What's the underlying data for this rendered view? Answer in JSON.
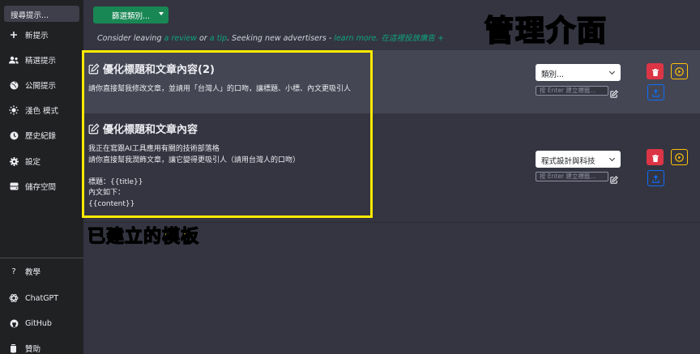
{
  "sidebar": {
    "search_placeholder": "搜尋提示...",
    "items": [
      {
        "label": "新提示",
        "icon": "plus-icon"
      },
      {
        "label": "精選提示",
        "icon": "users-icon"
      },
      {
        "label": "公開提示",
        "icon": "globe-icon"
      },
      {
        "label": "淺色 模式",
        "icon": "sun-icon"
      },
      {
        "label": "歷史紀錄",
        "icon": "clock-icon"
      },
      {
        "label": "設定",
        "icon": "gear-icon"
      },
      {
        "label": "儲存空間",
        "icon": "database-icon"
      }
    ],
    "bottom_items": [
      {
        "label": "教學",
        "icon": "question-icon"
      },
      {
        "label": "ChatGPT",
        "icon": "openai-icon"
      },
      {
        "label": "GitHub",
        "icon": "github-icon"
      },
      {
        "label": "贊助",
        "icon": "cup-icon"
      }
    ]
  },
  "topbar": {
    "filter_label": "篩選類別...",
    "ad": {
      "part1": "Consider leaving ",
      "review": "a review",
      "or": " or ",
      "tip": "a tip",
      "part2": ". Seeking new advertisers - ",
      "learn": "learn more.",
      "cta": " 在這裡投放廣告 +"
    }
  },
  "annotation": {
    "title": "管理介面",
    "caption": "已建立的模板"
  },
  "prompts": [
    {
      "title": "優化標題和文章內容(2)",
      "lines": [
        "請你直接幫我修改文章，並請用「台灣人」的口吻，讓標題、小標、內文更吸引人"
      ],
      "category": "類別...",
      "tag_placeholder": "按 Enter 建立標籤..."
    },
    {
      "title": "優化標題和文章內容",
      "lines": [
        "我正在寫跟AI工具應用有關的技術部落格",
        "請你直接幫我潤飾文章，讓它變得更吸引人（請用台灣人的口吻）",
        "",
        "標題：{{title}}",
        "內文如下：",
        "{{content}}"
      ],
      "category": "程式設計與科技",
      "tag_placeholder": "按 Enter 建立標籤..."
    }
  ],
  "colors": {
    "accent_green": "#198754",
    "link_green": "#10a37f",
    "delete_red": "#dc3545",
    "run_yellow": "#ffc107",
    "upload_blue": "#0d6efd",
    "annotation_yellow": "#ffea00"
  }
}
